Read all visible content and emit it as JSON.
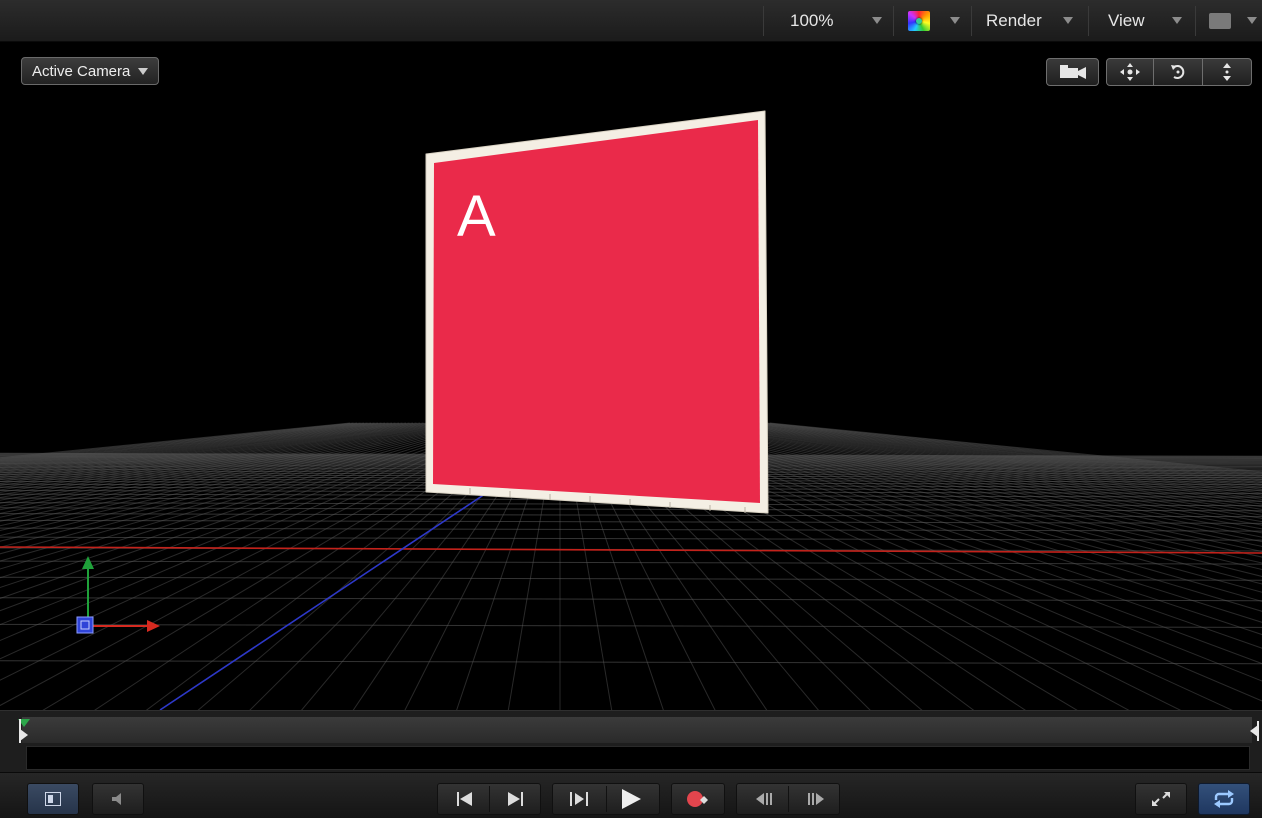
{
  "toolbar": {
    "zoom": "100%",
    "render_label": "Render",
    "view_label": "View"
  },
  "viewport": {
    "camera_menu_label": "Active Camera",
    "layer_text": "A",
    "layer_color": "#ea2a4a",
    "layer_border_color": "#f4efe4",
    "axis_colors": {
      "x": "#d62a20",
      "y": "#20a03a",
      "z": "#3a4fe0"
    }
  },
  "view_buttons": [
    "camera-icon",
    "pan-icon",
    "orbit-icon",
    "dolly-icon"
  ],
  "transport": {
    "buttons": [
      "show-hide-panel-icon",
      "audio-icon",
      "go-to-start-icon",
      "go-to-end-icon",
      "play-region-icon",
      "play-icon",
      "record-icon",
      "previous-frame-icon",
      "next-frame-icon",
      "fullscreen-icon",
      "loop-icon"
    ]
  }
}
